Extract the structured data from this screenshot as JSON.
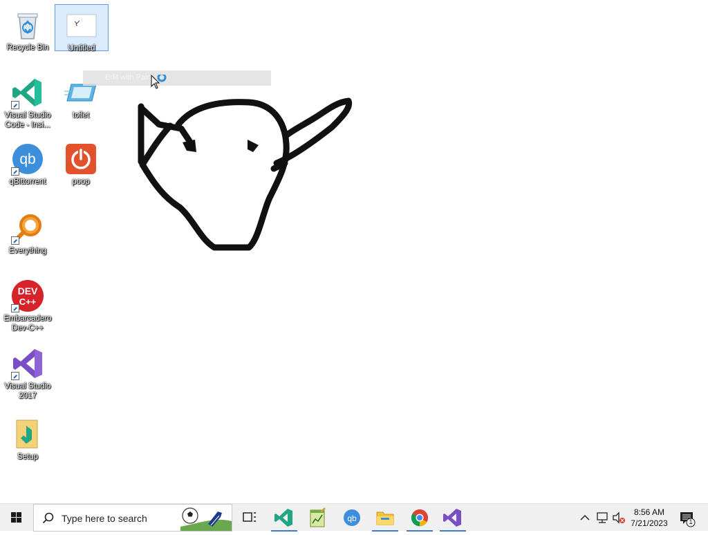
{
  "desktop": {
    "icons": [
      {
        "label": "Recycle Bin",
        "icon": "recycle-bin-icon"
      },
      {
        "label": "Untitled",
        "icon": "image-file-icon",
        "selected": true
      },
      {
        "label": "Visual Studio Code - Insi...",
        "icon": "vscode-insiders-icon"
      },
      {
        "label": "toilet",
        "icon": "tablet-icon"
      },
      {
        "label": "qBittorrent",
        "icon": "qbittorrent-icon"
      },
      {
        "label": "poop",
        "icon": "power-icon"
      },
      {
        "label": "Everything",
        "icon": "search-magnifier-icon"
      },
      {
        "label": "Embarcadero Dev-C++",
        "icon": "devcpp-icon"
      },
      {
        "label": "Visual Studio 2017",
        "icon": "visual-studio-icon"
      },
      {
        "label": "Setup",
        "icon": "setup-icon"
      }
    ],
    "drag_tooltip": "Edit with Paint"
  },
  "taskbar": {
    "search_placeholder": "Type here to search",
    "apps": [
      {
        "name": "vscode",
        "active": true
      },
      {
        "name": "editor",
        "active": false
      },
      {
        "name": "qbittorrent",
        "active": false
      },
      {
        "name": "file-explorer",
        "active": true
      },
      {
        "name": "chrome",
        "active": true
      },
      {
        "name": "visual-studio",
        "active": true
      }
    ],
    "clock": {
      "time": "8:56 AM",
      "date": "7/21/2023"
    },
    "notification_count": "1"
  },
  "colors": {
    "accent": "#3f7cc9",
    "taskbar_bg": "#f0f0f0",
    "desktop_bg": "#ffffff"
  }
}
